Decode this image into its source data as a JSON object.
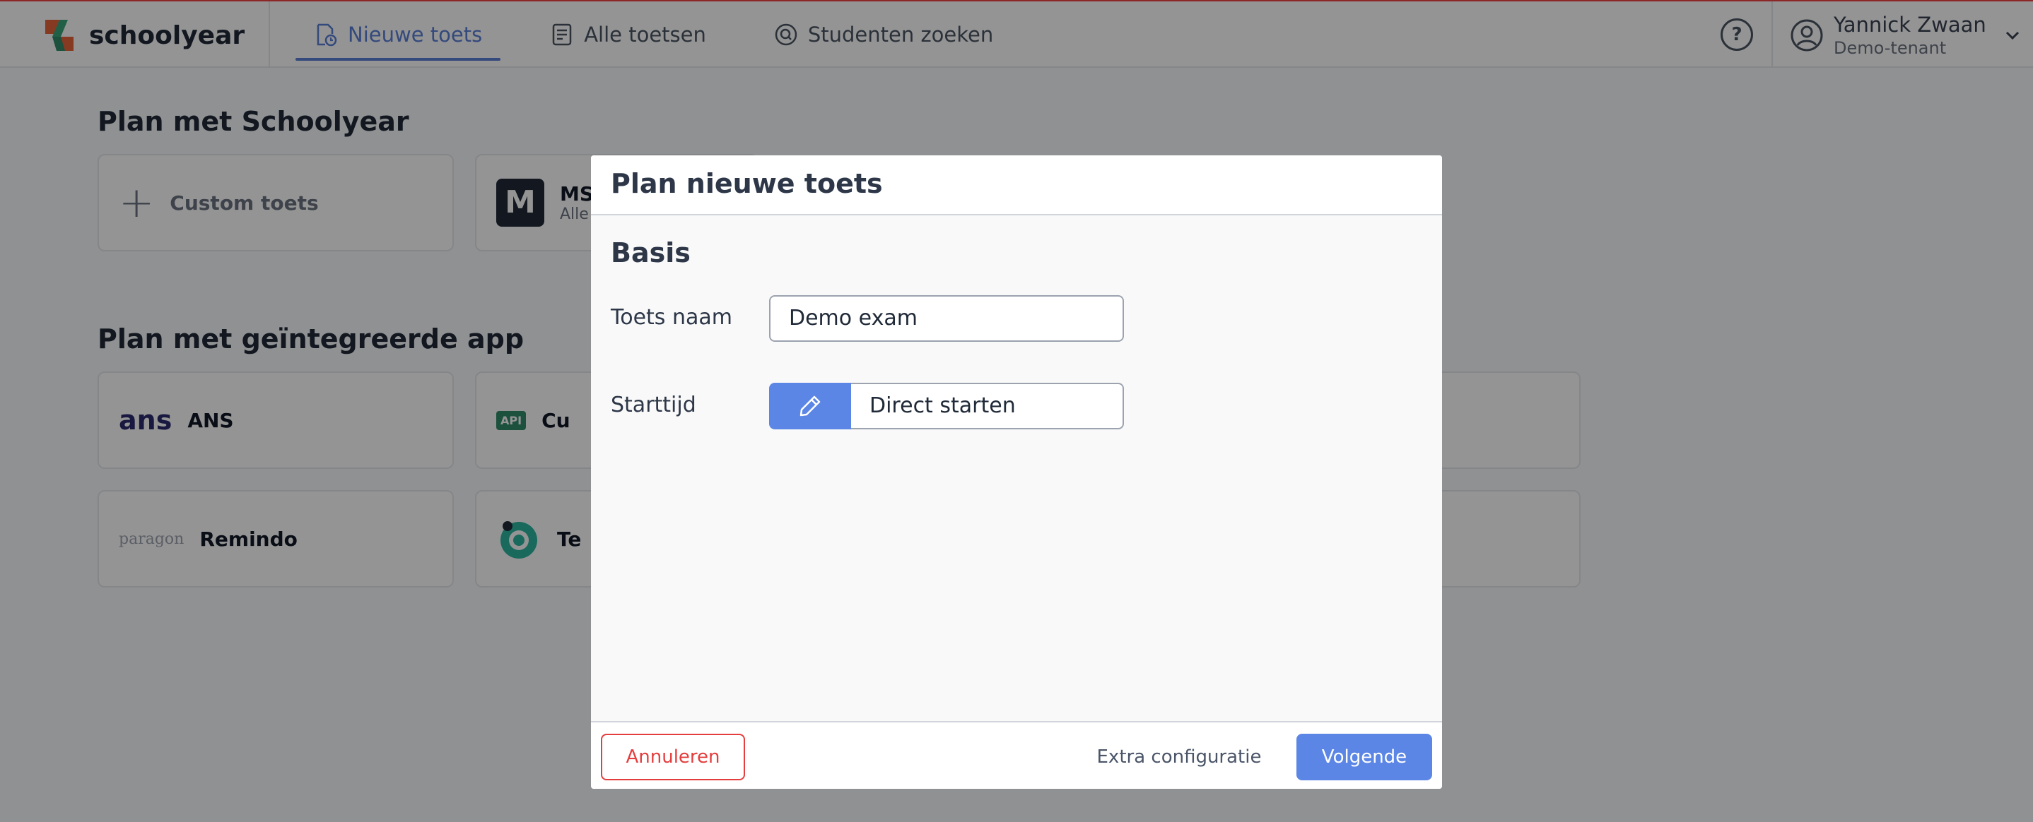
{
  "app": {
    "brand": "schoolyear",
    "nav": [
      {
        "label": "Nieuwe toets",
        "icon": "new-exam-icon",
        "active": true
      },
      {
        "label": "Alle toetsen",
        "icon": "list-icon",
        "active": false
      },
      {
        "label": "Studenten zoeken",
        "icon": "search-icon",
        "active": false
      }
    ],
    "help_symbol": "?",
    "user": {
      "name": "Yannick Zwaan",
      "tenant": "Demo-tenant"
    },
    "accent_color": "#5b86e5",
    "danger_color": "#e53e3e"
  },
  "page": {
    "section1_title": "Plan met Schoolyear",
    "custom_card": {
      "plus": "+",
      "label": "Custom toets"
    },
    "ms_card": {
      "badge": "M",
      "label": "MS",
      "sub": "Alle"
    },
    "section2_title": "Plan met geïntegreerde app",
    "apps": [
      {
        "logo": "ans",
        "label": "ANS"
      },
      {
        "logo": "API",
        "label": "Cu"
      },
      {
        "logo": "paragon",
        "label": "Remindo"
      },
      {
        "logo": "",
        "label": "Te"
      }
    ]
  },
  "modal": {
    "title": "Plan nieuwe toets",
    "section": "Basis",
    "name_label": "Toets naam",
    "name_value": "Demo exam",
    "start_label": "Starttijd",
    "start_value": "Direct starten",
    "cancel_label": "Annuleren",
    "extra_label": "Extra configuratie",
    "next_label": "Volgende"
  }
}
